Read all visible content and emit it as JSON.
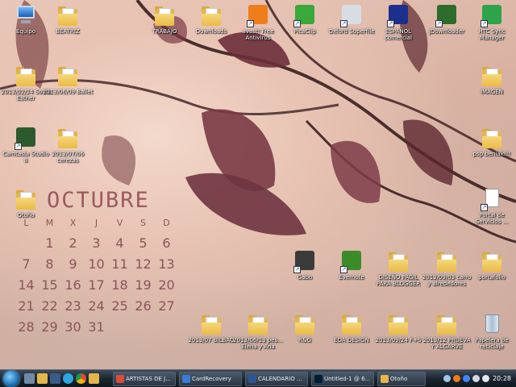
{
  "desktop_icons": [
    {
      "id": "equipo",
      "label": "Equipo",
      "icon": "computer-icon",
      "kind": "computer"
    },
    {
      "id": "beatriz",
      "label": "BEATRIZ",
      "icon": "folder-icon",
      "kind": "folder"
    },
    {
      "id": "trabajo",
      "label": "TRABAJO",
      "icon": "folder-icon",
      "kind": "folder"
    },
    {
      "id": "downloads",
      "label": "Downloads",
      "icon": "folder-icon",
      "kind": "folder"
    },
    {
      "id": "avast",
      "label": "avast! Free Antivirus",
      "icon": "avast-icon",
      "kind": "app",
      "color": "#f07d1c"
    },
    {
      "id": "picasa",
      "label": "PicaClip",
      "icon": "picaclip-icon",
      "kind": "app",
      "color": "#3aa83a"
    },
    {
      "id": "oxford",
      "label": "Oxford Superfile",
      "icon": "oxford-icon",
      "kind": "app",
      "color": "#d8dde3"
    },
    {
      "id": "espanol",
      "label": "ESPAÑOL comercial",
      "icon": "espanol-icon",
      "kind": "app",
      "color": "#1c2f8a"
    },
    {
      "id": "jdownloader",
      "label": "JDownloader",
      "icon": "jdownloader-icon",
      "kind": "app",
      "color": "#2f6b2a"
    },
    {
      "id": "htc",
      "label": "HTC Sync Manager",
      "icon": "htc-sync-icon",
      "kind": "app",
      "color": "#2fa34a"
    },
    {
      "id": "f1",
      "label": "2013/02/24 Sonia Esther",
      "icon": "folder-icon",
      "kind": "folder"
    },
    {
      "id": "f2",
      "label": "2013/06/09 Ballet",
      "icon": "folder-icon",
      "kind": "folder"
    },
    {
      "id": "imagen",
      "label": "IMAGEN",
      "icon": "folder-icon",
      "kind": "folder"
    },
    {
      "id": "camtasia",
      "label": "Camtasia Studio 8",
      "icon": "camtasia-icon",
      "kind": "app",
      "color": "#2d5a2d"
    },
    {
      "id": "f3",
      "label": "2013/07/06 cerezas",
      "icon": "folder-icon",
      "kind": "folder"
    },
    {
      "id": "psp",
      "label": "psp beniak!!!",
      "icon": "folder-icon",
      "kind": "folder"
    },
    {
      "id": "otono",
      "label": "Otoño",
      "icon": "folder-icon",
      "kind": "folder"
    },
    {
      "id": "portal",
      "label": "Portal de Servicios ...",
      "icon": "document-icon",
      "kind": "doc"
    },
    {
      "id": "gabo",
      "label": "Gabo",
      "icon": "gabo-icon",
      "kind": "app",
      "color": "#3b3b3b"
    },
    {
      "id": "evernote",
      "label": "Evernote",
      "icon": "evernote-icon",
      "kind": "app",
      "color": "#3c8b2a"
    },
    {
      "id": "diseno",
      "label": "DISEÑO PÁGIL PARA BLOGGER",
      "icon": "folder-icon",
      "kind": "folder"
    },
    {
      "id": "f4",
      "label": "2013/09/03 carro y alrededores",
      "icon": "folder-icon",
      "kind": "folder"
    },
    {
      "id": "portafolio",
      "label": "portafolio",
      "icon": "folder-icon",
      "kind": "folder"
    },
    {
      "id": "f5",
      "label": "2013/07 BILBAO",
      "icon": "folder-icon",
      "kind": "folder"
    },
    {
      "id": "f6",
      "label": "2013/06/13 pes... Elena y Ana",
      "icon": "folder-icon",
      "kind": "folder"
    },
    {
      "id": "rag",
      "label": "R&G",
      "icon": "folder-icon",
      "kind": "folder"
    },
    {
      "id": "eda",
      "label": "EDA DESIGN",
      "icon": "folder-icon",
      "kind": "folder"
    },
    {
      "id": "f7",
      "label": "2013/09/24 F+S",
      "icon": "folder-icon",
      "kind": "folder"
    },
    {
      "id": "f8",
      "label": "2013/12 PRUEVA Y ALGARVE",
      "icon": "folder-icon",
      "kind": "folder"
    },
    {
      "id": "papelera",
      "label": "Papelera de reciclaje",
      "icon": "recycle-bin-icon",
      "kind": "bin"
    }
  ],
  "calendar": {
    "title": "OCTUBRE",
    "days": [
      "L",
      "M",
      "X",
      "J",
      "V",
      "S",
      "D"
    ],
    "weeks": [
      [
        "",
        "1",
        "2",
        "3",
        "4",
        "5",
        "6"
      ],
      [
        "7",
        "8",
        "9",
        "10",
        "11",
        "12",
        "13"
      ],
      [
        "14",
        "15",
        "16",
        "17",
        "18",
        "19",
        "20"
      ],
      [
        "21",
        "22",
        "23",
        "24",
        "25",
        "26",
        "27"
      ],
      [
        "28",
        "29",
        "30",
        "31",
        "",
        "",
        ""
      ]
    ]
  },
  "taskbar": {
    "buttons": [
      {
        "label": "ARTISTAS DE J...",
        "icon": "chrome-icon",
        "color": "#dd4b39"
      },
      {
        "label": "CardRecovery",
        "icon": "cardrecovery-icon",
        "color": "#3a7bd5"
      },
      {
        "label": "CALENDARIO ...",
        "icon": "word-icon",
        "color": "#2b5797"
      },
      {
        "label": "Untitled-1 @ 6...",
        "icon": "photoshop-icon",
        "color": "#001e36"
      },
      {
        "label": "Otoño",
        "icon": "folder-icon",
        "color": "#e3b64a"
      }
    ],
    "clock": "20:28"
  }
}
